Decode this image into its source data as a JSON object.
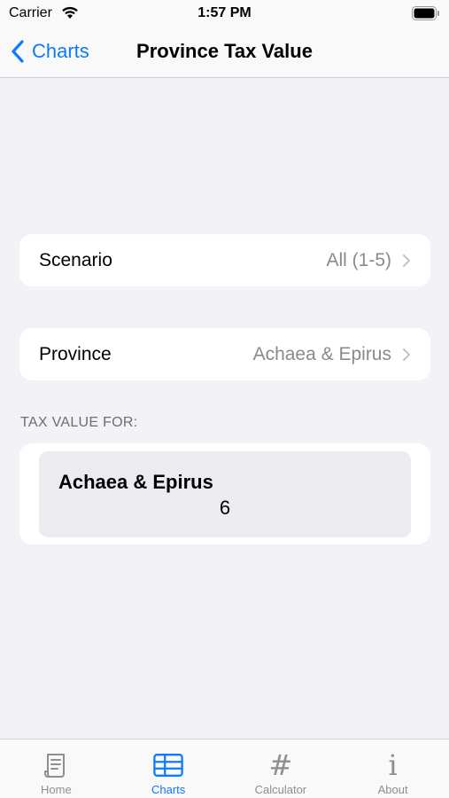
{
  "status": {
    "carrier": "Carrier",
    "time": "1:57 PM"
  },
  "nav": {
    "back_label": "Charts",
    "title": "Province Tax Value"
  },
  "rows": {
    "scenario": {
      "label": "Scenario",
      "value": "All (1-5)"
    },
    "province": {
      "label": "Province",
      "value": "Achaea & Epirus"
    }
  },
  "section_header": "TAX VALUE FOR:",
  "result": {
    "province": "Achaea & Epirus",
    "value": "6"
  },
  "tabs": [
    {
      "label": "Home",
      "icon": "scroll-icon",
      "active": false
    },
    {
      "label": "Charts",
      "icon": "table-icon",
      "active": true
    },
    {
      "label": "Calculator",
      "icon": "hash-icon",
      "glyph": "#",
      "active": false
    },
    {
      "label": "About",
      "icon": "info-icon",
      "glyph": "i",
      "active": false
    }
  ],
  "colors": {
    "accent": "#0a7aff",
    "background": "#f2f2f7",
    "secondary_text": "#8a8a8e"
  }
}
